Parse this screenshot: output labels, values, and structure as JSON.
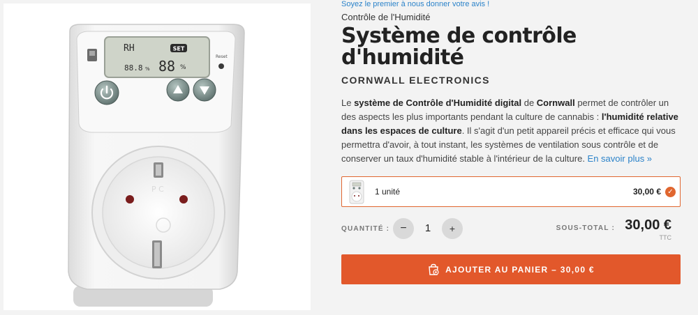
{
  "review_prompt": "Soyez le premier à nous donner votre avis !",
  "breadcrumb": "Contrôle de l'Humidité",
  "product": {
    "title": "Système de contrôle d'humidité",
    "brand": "CORNWALL ELECTRONICS",
    "description": {
      "p1": "Le ",
      "b1": "système de Contrôle d'Humidité digital",
      "p2": " de ",
      "b2": "Cornwall",
      "p3": " permet de contrôler un des aspects les plus importants pendant la culture de cannabis : ",
      "b3": "l'humidité relative dans les espaces de culture",
      "p4": ". Il s'agit d'un petit appareil précis et efficace qui vous permettra d'avoir, à tout instant, les systèmes de ventilation sous contrôle et de conserver un taux d'humidité stable à l'intérieur de la culture. ",
      "more": "En savoir plus »"
    }
  },
  "device_display": {
    "mode": "RH",
    "badge": "SET",
    "reading_small": "88.8",
    "small_unit": "%",
    "reading_large": "88",
    "large_unit": "%",
    "reset_label": "Reset",
    "socket_mark": "P C"
  },
  "variant": {
    "label": "1 unité",
    "price": "30,00 €",
    "check_icon": "check-icon",
    "check_glyph": "✓"
  },
  "quantity": {
    "label": "QUANTITÉ :",
    "value": "1",
    "minus": "−",
    "plus": "+"
  },
  "subtotal": {
    "label": "SOUS-TOTAL :",
    "value": "30,00 €",
    "tax": "TTC"
  },
  "cart": {
    "label": "AJOUTER AU PANIER – 30,00 €",
    "icon": "shopping-bag-icon"
  },
  "colors": {
    "accent": "#e2582b",
    "link": "#2a82c9",
    "background": "#f3f3f3"
  }
}
